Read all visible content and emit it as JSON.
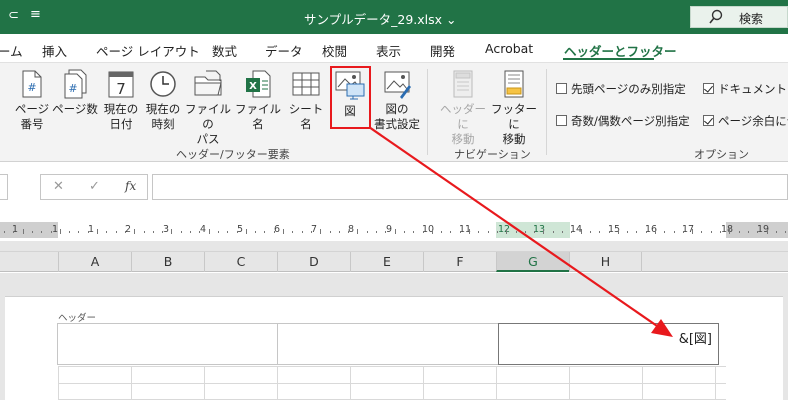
{
  "title_bar": {
    "quick_access": "⊂",
    "quick_access2": "≡",
    "document_title": "サンプルデータ_29.xlsx",
    "dropdown": "⌄",
    "search_label": "検索",
    "search_icon": "search-icon"
  },
  "tabs": [
    {
      "label": "ーム"
    },
    {
      "label": "挿入"
    },
    {
      "label": "ページ レイアウト"
    },
    {
      "label": "数式"
    },
    {
      "label": "データ"
    },
    {
      "label": "校閲"
    },
    {
      "label": "表示"
    },
    {
      "label": "開発"
    },
    {
      "label": "Acrobat"
    },
    {
      "label": "ヘッダーとフッター"
    }
  ],
  "ribbon": {
    "header_footer_elements": {
      "group_label": "ヘッダー/フッター要素",
      "buttons": [
        {
          "line1": "ページ",
          "line2": "番号"
        },
        {
          "line1": "ページ数",
          "line2": ""
        },
        {
          "line1": "現在の",
          "line2": "日付"
        },
        {
          "line1": "現在の",
          "line2": "時刻"
        },
        {
          "line1": "ファイルの",
          "line2": "パス"
        },
        {
          "line1": "ファイル名",
          "line2": ""
        },
        {
          "line1": "シート名",
          "line2": ""
        },
        {
          "line1": "図",
          "line2": ""
        },
        {
          "line1": "図の",
          "line2": "書式設定"
        }
      ],
      "calendar_day": "7"
    },
    "navigation": {
      "group_label": "ナビゲーション",
      "buttons": [
        {
          "line1": "ヘッダーに",
          "line2": "移動"
        },
        {
          "line1": "フッターに",
          "line2": "移動"
        }
      ]
    },
    "options": {
      "group_label": "オプション",
      "checkboxes": [
        {
          "label": "先頭ページのみ別指定",
          "checked": false
        },
        {
          "label": "奇数/偶数ページ別指定",
          "checked": false
        },
        {
          "label": "ドキュメントに合",
          "checked": true
        },
        {
          "label": "ページ余白に合",
          "checked": true
        }
      ]
    }
  },
  "formula_bar": {
    "cancel": "✕",
    "enter": "✓",
    "fx": "fx"
  },
  "ruler": {
    "numbers": [
      "1",
      "1",
      "1",
      "2",
      "3",
      "4",
      "5",
      "6",
      "7",
      "8",
      "9",
      "10",
      "11",
      "12",
      "13",
      "14",
      "15",
      "16",
      "17",
      "18",
      "19"
    ],
    "highlighted": [
      "12",
      "13"
    ]
  },
  "columns": [
    "A",
    "B",
    "C",
    "D",
    "E",
    "F",
    "G",
    "H"
  ],
  "selected_column": "G",
  "page": {
    "header_label": "ヘッダー",
    "right_section_text": "&[図]"
  },
  "colors": {
    "excel_green": "#217346",
    "annotation_red": "#e8191d"
  }
}
